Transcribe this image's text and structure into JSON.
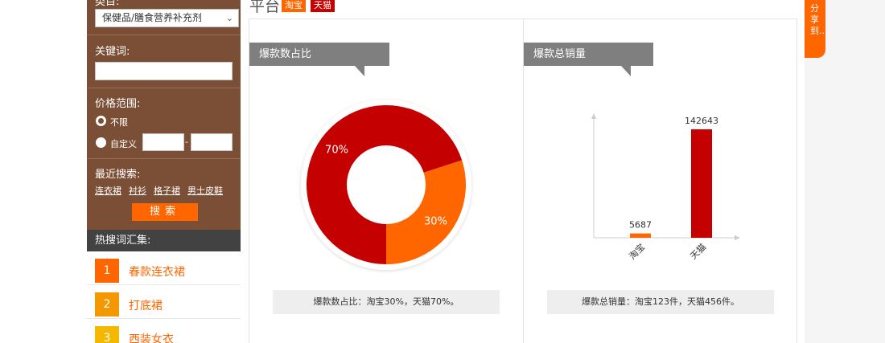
{
  "sidebar": {
    "category_label": "类目:",
    "category_value": "保健品/膳食营养补充剂",
    "keyword_label": "关键词:",
    "keyword_value": "",
    "price_label": "价格范围:",
    "price_options": [
      {
        "label": "不限",
        "checked": true
      },
      {
        "label": "自定义",
        "checked": false
      }
    ],
    "price_min": "",
    "price_max": "",
    "price_dash": "-",
    "recent_label": "最近搜索:",
    "recent_items": [
      "连衣裙",
      "衬衫",
      "格子裙",
      "男士皮鞋"
    ],
    "search_button": "搜索",
    "hot_title": "热搜词汇集:",
    "hot_items": [
      {
        "rank": "1",
        "text": "春款连衣裙",
        "color": "#ff6600"
      },
      {
        "rank": "2",
        "text": "打底裙",
        "color": "#f39800"
      },
      {
        "rank": "3",
        "text": "西装女衣",
        "color": "#f5b800"
      }
    ]
  },
  "main": {
    "title": "平台",
    "tags": [
      "淘宝",
      "天猫"
    ],
    "share_text": "分享到..."
  },
  "panels": [
    {
      "tab": "爆款数占比",
      "caption": "爆款数占比：淘宝30%，天猫70%。"
    },
    {
      "tab": "爆款总销量",
      "caption": "爆款总销量：淘宝123件，天猫456件。"
    }
  ],
  "colors": {
    "taobao": "#ff6600",
    "tmall": "#c40000",
    "sidebar_bg": "#7b4f36",
    "accent": "#ff6600"
  },
  "chart_data": [
    {
      "type": "pie",
      "categories": [
        "淘宝",
        "天猫"
      ],
      "values": [
        30,
        70
      ],
      "labels": [
        "30%",
        "70%"
      ],
      "colors": [
        "#ff6600",
        "#c40000"
      ],
      "donut": true
    },
    {
      "type": "bar",
      "categories": [
        "淘宝",
        "天猫"
      ],
      "values": [
        5687,
        142643
      ],
      "colors": [
        "#ff6600",
        "#c40000"
      ],
      "grid": false
    }
  ]
}
